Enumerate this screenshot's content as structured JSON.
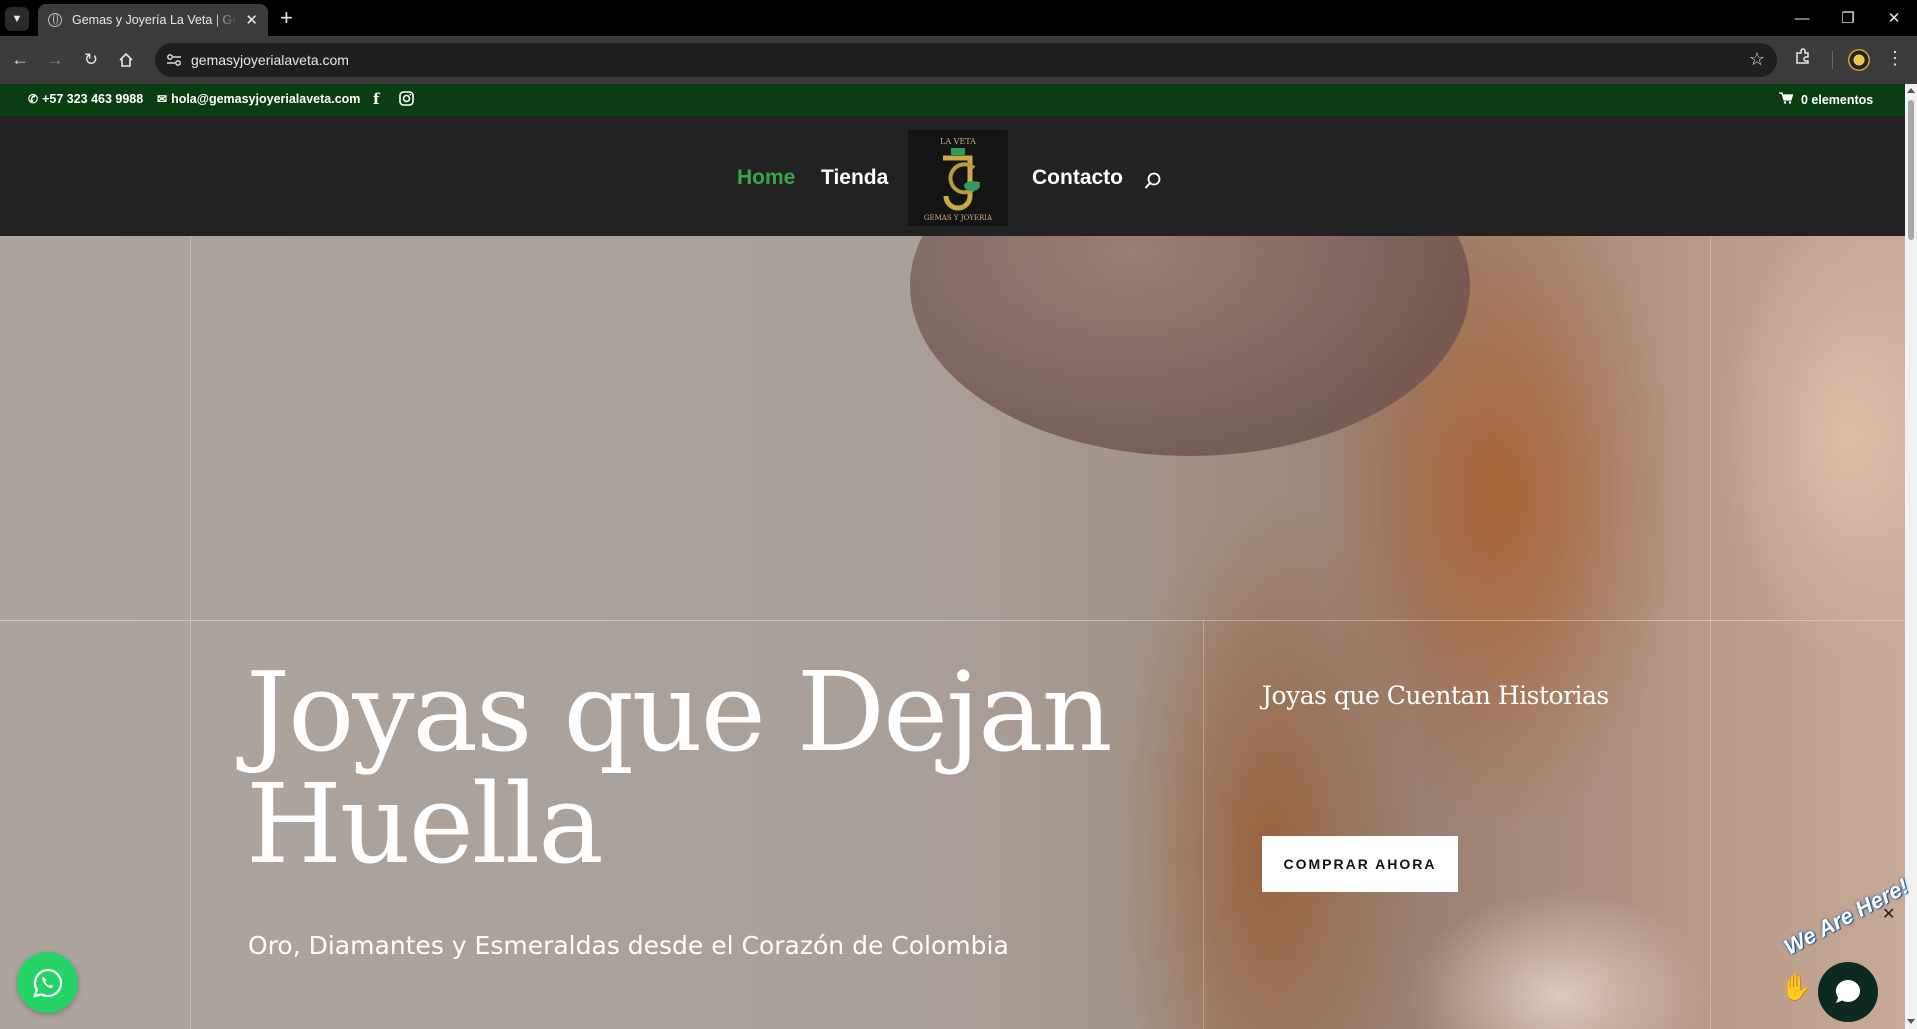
{
  "browser": {
    "tab_title": "Gemas y Joyería La Veta | Gemas y Joyería La Veta",
    "tab_close": "✕",
    "new_tab": "+",
    "url": "gemasyjoyerialaveta.com"
  },
  "topbar": {
    "phone": "+57 323 463 9988",
    "email": "hola@gemasyjoyerialaveta.com",
    "cart": "0 elementos"
  },
  "nav": {
    "items": [
      {
        "label": "Home",
        "active": true
      },
      {
        "label": "Tienda",
        "active": false
      },
      {
        "label": "Contacto",
        "active": false
      }
    ],
    "logo_top": "LA VETA",
    "logo_bottom": "GEMAS Y JOYERIA",
    "logo_monogram": "JG"
  },
  "hero": {
    "title_line1": "Joyas que Dejan",
    "title_line2": "Huella",
    "subtitle": "Oro, Diamantes y Esmeraldas desde el Corazón de Colombia",
    "side_title": "Joyas que Cuentan Historias",
    "cta_label": "COMPRAR AHORA"
  },
  "chat": {
    "badge_text": "We Are Here!",
    "close_symbol": "✕"
  },
  "colors": {
    "topbar_bg": "#0b3d12",
    "nav_bg": "#222222",
    "active_link": "#3aa64a",
    "whatsapp": "#25d366"
  },
  "icons": [
    "tab-list-icon",
    "globe-icon",
    "back-icon",
    "forward-icon",
    "reload-icon",
    "home-icon",
    "site-info-icon",
    "star-icon",
    "extensions-icon",
    "profile-icon",
    "menu-icon",
    "phone-icon",
    "mail-icon",
    "facebook-icon",
    "instagram-icon",
    "cart-icon",
    "search-icon",
    "whatsapp-icon",
    "chat-icon",
    "wave-hand-icon"
  ]
}
